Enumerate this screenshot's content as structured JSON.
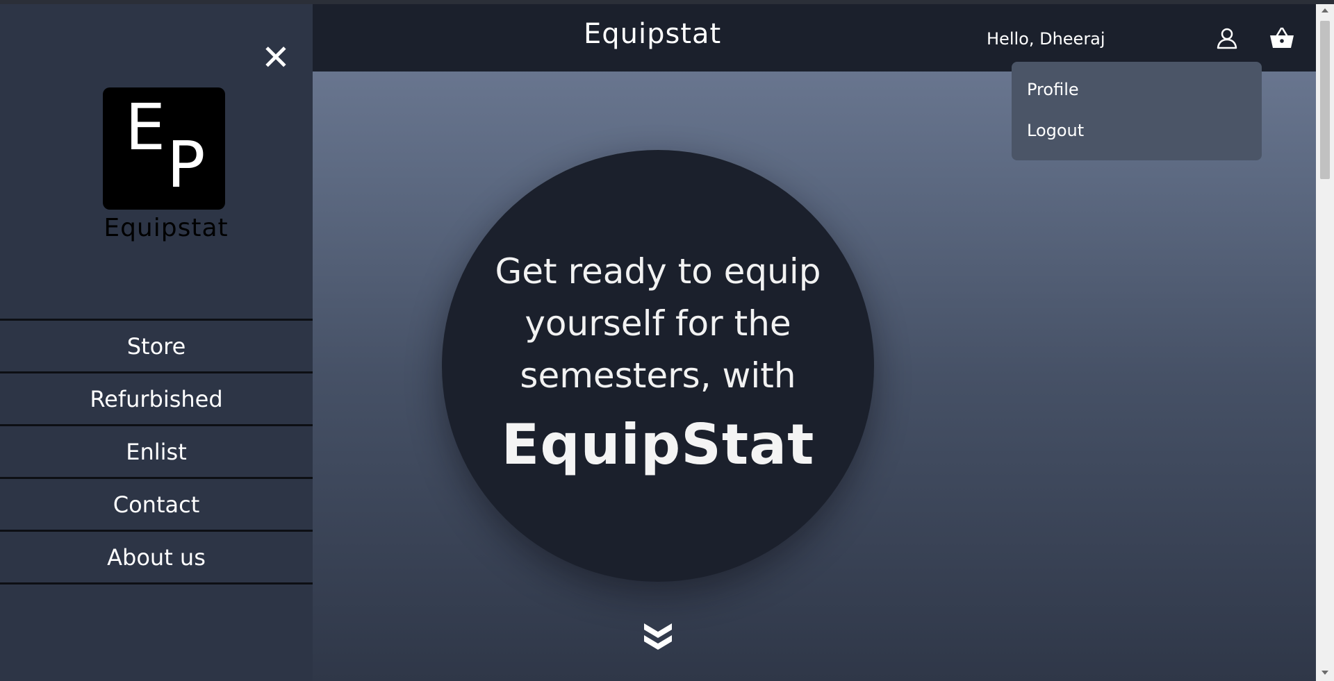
{
  "sidebar": {
    "logo": {
      "letter1": "E",
      "letter2": "P",
      "text": "Equipstat"
    },
    "close_icon": "close-icon",
    "items": [
      {
        "label": "Store"
      },
      {
        "label": "Refurbished"
      },
      {
        "label": "Enlist"
      },
      {
        "label": "Contact"
      },
      {
        "label": "About us"
      }
    ]
  },
  "header": {
    "brand": "Equipstat",
    "greeting": "Hello, Dheeraj",
    "icons": [
      "user-icon",
      "basket-icon"
    ]
  },
  "dropdown": {
    "items": [
      {
        "label": "Profile"
      },
      {
        "label": "Logout"
      }
    ]
  },
  "hero": {
    "line1": "Get ready to equip",
    "line2": "yourself for the",
    "line3": "semesters, with",
    "brand": "EquipStat",
    "scroll_icon": "double-chevron-down-icon"
  },
  "colors": {
    "sidebar_bg": "#2d3546",
    "header_bg": "#1b202c",
    "dropdown_bg": "#4b5567",
    "hero_circle": "#1b202c"
  }
}
